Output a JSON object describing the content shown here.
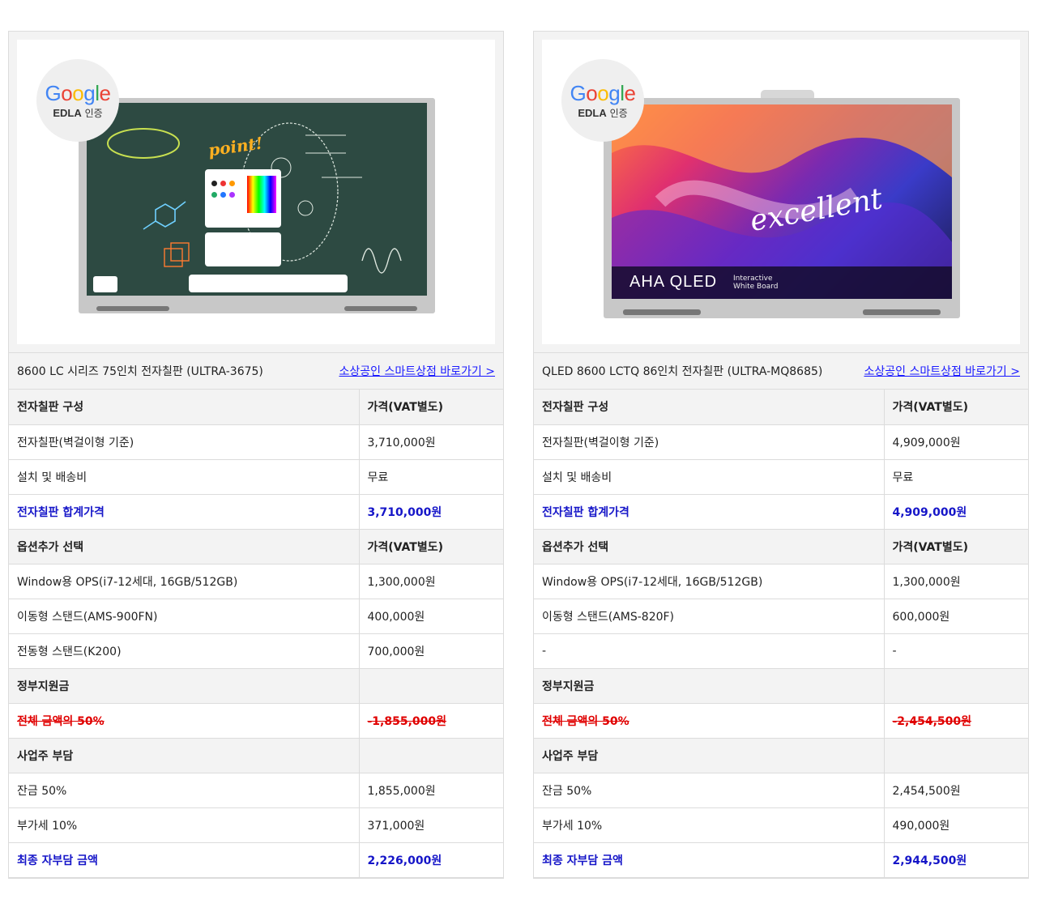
{
  "cards": [
    {
      "badge": {
        "brand": "Google",
        "sub_bold": "EDLA",
        "sub": "인증"
      },
      "screen_text": "point!",
      "product_name": "8600 LC 시리즈 75인치 전자칠판 (ULTRA-3675)",
      "link_label": "소상공인 스마트상점 바로가기 >",
      "rows": [
        {
          "type": "head",
          "label": "전자칠판 구성",
          "value": "가격(VAT별도)"
        },
        {
          "type": "normal",
          "label": "전자칠판(벽걸이형 기준)",
          "value": "3,710,000원"
        },
        {
          "type": "normal",
          "label": "설치 및 배송비",
          "value": "무료"
        },
        {
          "type": "blue",
          "label": "전자칠판 합계가격",
          "value": "3,710,000원"
        },
        {
          "type": "head",
          "label": "옵션추가 선택",
          "value": "가격(VAT별도)"
        },
        {
          "type": "normal",
          "label": "Window용 OPS(i7-12세대, 16GB/512GB)",
          "value": "1,300,000원"
        },
        {
          "type": "normal",
          "label": "이동형 스탠드(AMS-900FN)",
          "value": "400,000원"
        },
        {
          "type": "normal",
          "label": "전동형 스탠드(K200)",
          "value": "700,000원"
        },
        {
          "type": "section",
          "label": "정부지원금",
          "value": ""
        },
        {
          "type": "red",
          "label": "전체 금액의 50%",
          "value": "-1,855,000원"
        },
        {
          "type": "section",
          "label": "사업주 부담",
          "value": ""
        },
        {
          "type": "normal",
          "label": "잔금 50%",
          "value": "1,855,000원"
        },
        {
          "type": "normal",
          "label": "부가세 10%",
          "value": "371,000원"
        },
        {
          "type": "blue",
          "label": "최종 자부담 금액",
          "value": "2,226,000원"
        }
      ]
    },
    {
      "badge": {
        "brand": "Google",
        "sub_bold": "EDLA",
        "sub": "인증"
      },
      "screen_text": "excellent",
      "screen_logo": "AHA QLED",
      "screen_logo_sub": "Interactive White Board",
      "product_name": "QLED 8600 LCTQ 86인치 전자칠판 (ULTRA-MQ8685)",
      "link_label": "소상공인 스마트상점 바로가기 >",
      "rows": [
        {
          "type": "head",
          "label": "전자칠판 구성",
          "value": "가격(VAT별도)"
        },
        {
          "type": "normal",
          "label": "전자칠판(벽걸이형 기준)",
          "value": "4,909,000원"
        },
        {
          "type": "normal",
          "label": "설치 및 배송비",
          "value": "무료"
        },
        {
          "type": "blue",
          "label": "전자칠판 합계가격",
          "value": "4,909,000원"
        },
        {
          "type": "head",
          "label": "옵션추가 선택",
          "value": "가격(VAT별도)"
        },
        {
          "type": "normal",
          "label": "Window용 OPS(i7-12세대, 16GB/512GB)",
          "value": "1,300,000원"
        },
        {
          "type": "normal",
          "label": "이동형 스탠드(AMS-820F)",
          "value": "600,000원"
        },
        {
          "type": "normal",
          "label": "-",
          "value": "-"
        },
        {
          "type": "section",
          "label": "정부지원금",
          "value": ""
        },
        {
          "type": "red",
          "label": "전체 금액의 50%",
          "value": "-2,454,500원"
        },
        {
          "type": "section",
          "label": "사업주 부담",
          "value": ""
        },
        {
          "type": "normal",
          "label": "잔금 50%",
          "value": "2,454,500원"
        },
        {
          "type": "normal",
          "label": "부가세 10%",
          "value": "490,000원"
        },
        {
          "type": "blue",
          "label": "최종 자부담 금액",
          "value": "2,944,500원"
        }
      ]
    }
  ]
}
